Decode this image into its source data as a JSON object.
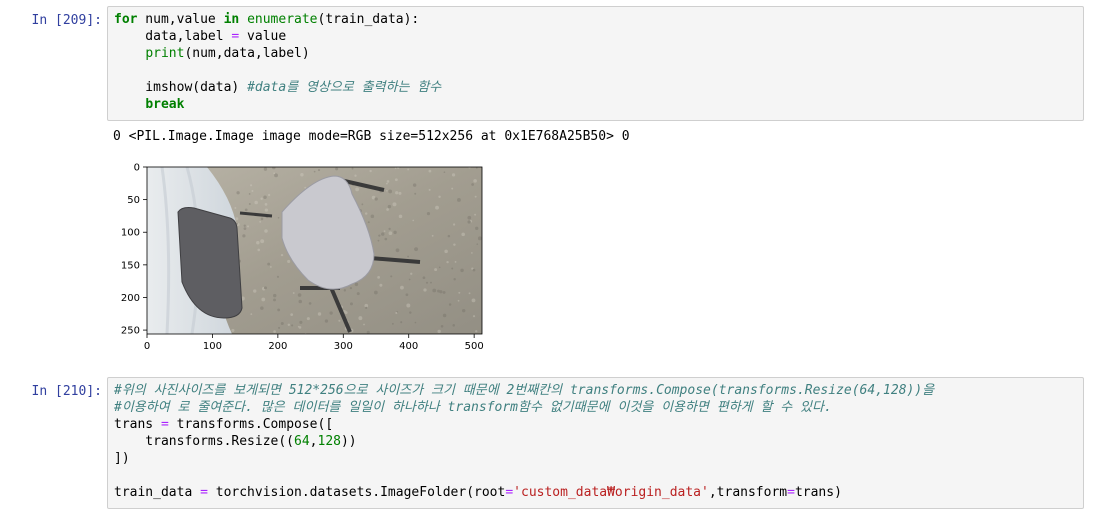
{
  "cells": [
    {
      "prompt": "In [209]:",
      "code_lines": [
        [
          {
            "t": "for",
            "c": "kw"
          },
          {
            "t": " num,value ",
            "c": ""
          },
          {
            "t": "in",
            "c": "kw"
          },
          {
            "t": " ",
            "c": ""
          },
          {
            "t": "enumerate",
            "c": "bi"
          },
          {
            "t": "(train_data):",
            "c": ""
          }
        ],
        [
          {
            "t": "    data,label ",
            "c": ""
          },
          {
            "t": "=",
            "c": "op"
          },
          {
            "t": " value",
            "c": ""
          }
        ],
        [
          {
            "t": "    ",
            "c": ""
          },
          {
            "t": "print",
            "c": "bi"
          },
          {
            "t": "(num,data,label)",
            "c": ""
          }
        ],
        [
          {
            "t": "",
            "c": ""
          }
        ],
        [
          {
            "t": "    imshow(data) ",
            "c": ""
          },
          {
            "t": "#data를 영상으로 출력하는 함수",
            "c": "cm"
          }
        ],
        [
          {
            "t": "    ",
            "c": ""
          },
          {
            "t": "break",
            "c": "kw"
          }
        ]
      ]
    },
    {
      "prompt": "In [210]:",
      "code_lines": [
        [
          {
            "t": "#위의 사진사이즈를 보게되면 512*256으로 사이즈가 크기 때문에 2번째칸의 transforms.Compose(transforms.Resize(64,128))을",
            "c": "cm"
          }
        ],
        [
          {
            "t": "#이용하여 로 줄여준다. 많은 데이터를 일일이 하나하나 transform함수 없기때문에 이것을 이용하면 편하게 할 수 있다.",
            "c": "cm"
          }
        ],
        [
          {
            "t": "trans ",
            "c": ""
          },
          {
            "t": "=",
            "c": "op"
          },
          {
            "t": " transforms.Compose([",
            "c": ""
          }
        ],
        [
          {
            "t": "    transforms.Resize((",
            "c": ""
          },
          {
            "t": "64",
            "c": "num"
          },
          {
            "t": ",",
            "c": ""
          },
          {
            "t": "128",
            "c": "num"
          },
          {
            "t": "))",
            "c": ""
          }
        ],
        [
          {
            "t": "])",
            "c": ""
          }
        ],
        [
          {
            "t": "",
            "c": ""
          }
        ],
        [
          {
            "t": "train_data ",
            "c": ""
          },
          {
            "t": "=",
            "c": "op"
          },
          {
            "t": " torchvision.datasets.ImageFolder(root",
            "c": ""
          },
          {
            "t": "=",
            "c": "op"
          },
          {
            "t": "'custom_data₩origin_data'",
            "c": "str"
          },
          {
            "t": ",transform",
            "c": ""
          },
          {
            "t": "=",
            "c": "op"
          },
          {
            "t": "trans)",
            "c": ""
          }
        ]
      ]
    }
  ],
  "output": {
    "text": "0 <PIL.Image.Image image mode=RGB size=512x256 at 0x1E768A25B50> 0",
    "image_alt": "chair photo"
  },
  "chart_data": {
    "type": "image",
    "x_ticks": [
      "0",
      "100",
      "200",
      "300",
      "400",
      "500"
    ],
    "x_tick_values": [
      0,
      100,
      200,
      300,
      400,
      500
    ],
    "y_ticks": [
      "0",
      "50",
      "100",
      "150",
      "200",
      "250"
    ],
    "y_tick_values": [
      0,
      50,
      100,
      150,
      200,
      250
    ],
    "xlim": [
      0,
      512
    ],
    "ylim": [
      256,
      0
    ]
  }
}
